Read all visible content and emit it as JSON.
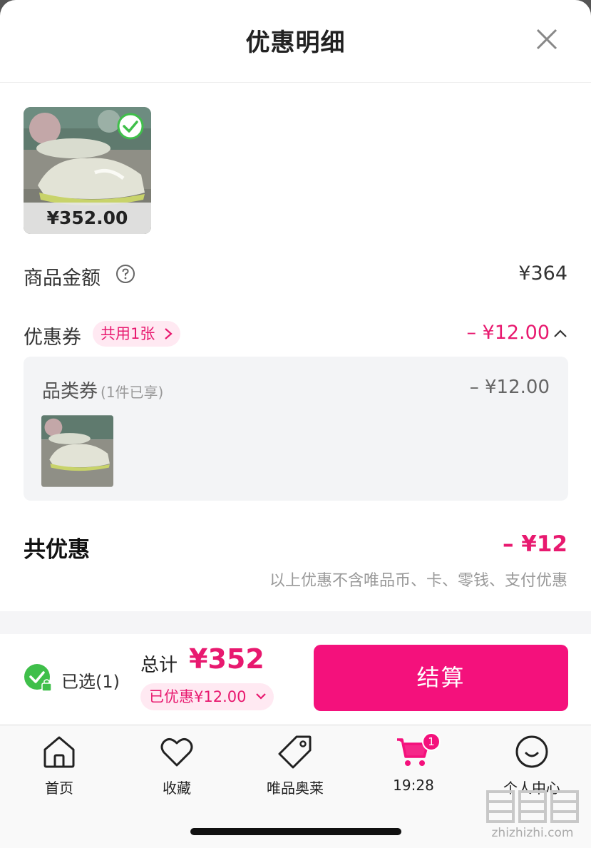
{
  "header": {
    "title": "优惠明细"
  },
  "product": {
    "price": "¥352.00"
  },
  "goods_amount": {
    "label": "商品金额",
    "value": "¥364"
  },
  "coupon": {
    "label": "优惠券",
    "pill": "共用1张",
    "value": "– ¥12.00"
  },
  "category_coupon": {
    "label": "品类券",
    "sub": "(1件已享)",
    "value": "– ¥12.00"
  },
  "total_discount": {
    "label": "共优惠",
    "value": "– ¥12",
    "note": "以上优惠不含唯品币、卡、零钱、支付优惠"
  },
  "checkout": {
    "selected": "已选(1)",
    "total_label": "总计",
    "total_value": "¥352",
    "saved": "已优惠¥12.00",
    "pay_label": "结算"
  },
  "tabs": [
    {
      "label": "首页",
      "icon": "home-icon"
    },
    {
      "label": "收藏",
      "icon": "heart-icon"
    },
    {
      "label": "唯品奥莱",
      "icon": "tag-icon"
    },
    {
      "label": "19:28",
      "icon": "cart-icon",
      "badge": "1"
    },
    {
      "label": "个人中心",
      "icon": "smile-icon"
    }
  ],
  "watermark": {
    "text": "zhizhizhi.com",
    "logo": "值值值"
  },
  "colors": {
    "accent": "#f4117c",
    "accent_text": "#e8196f",
    "success": "#3fbf4a"
  }
}
